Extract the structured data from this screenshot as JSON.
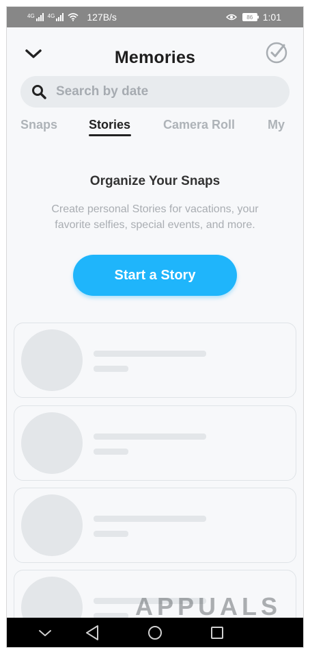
{
  "status_bar": {
    "network_1": "4G",
    "network_2": "4G",
    "speed": "127B/s",
    "battery": "86",
    "time": "1:01"
  },
  "header": {
    "title": "Memories",
    "back_icon": "chevron-down-icon",
    "select_icon": "check-circle-icon"
  },
  "search": {
    "placeholder": "Search by date",
    "value": ""
  },
  "tabs": [
    {
      "label": "Snaps",
      "active": false
    },
    {
      "label": "Stories",
      "active": true
    },
    {
      "label": "Camera Roll",
      "active": false
    },
    {
      "label": "My",
      "active": false
    }
  ],
  "empty_state": {
    "title": "Organize Your Snaps",
    "description": "Create personal Stories for vacations, your favorite selfies, special events, and more.",
    "cta_label": "Start a Story"
  },
  "watermark": "APPUALS",
  "colors": {
    "accent": "#1fb5fb",
    "status_bar": "#878787",
    "placeholder": "#e3e6e9"
  }
}
